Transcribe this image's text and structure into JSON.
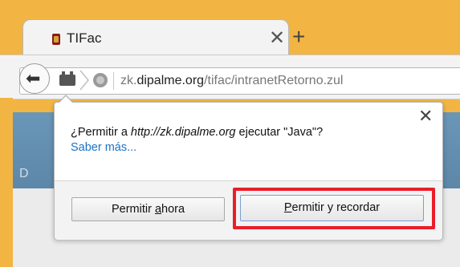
{
  "tab": {
    "title": "TIFac",
    "close_icon": "close-icon",
    "new_tab_icon": "plus-icon"
  },
  "navbar": {
    "back_icon": "back-arrow-icon",
    "url_prefix": "zk.",
    "url_domain": "dipalme.org",
    "url_path": "/tifac/intranetRetorno.zul"
  },
  "page": {
    "partial_text": "D"
  },
  "popup": {
    "message_pre": "¿Permitir a ",
    "message_url": "http://zk.dipalme.org",
    "message_post": " ejecutar \"Java\"?",
    "learn_more": "Saber más...",
    "button_allow_now_pre": "Permitir ",
    "button_allow_now_ul": "a",
    "button_allow_now_post": "hora",
    "button_allow_remember_ul": "P",
    "button_allow_remember_post": "ermitir y recordar"
  },
  "colors": {
    "frame": "#f2b543",
    "highlight": "#ea1d2a",
    "link": "#1a73c8"
  }
}
